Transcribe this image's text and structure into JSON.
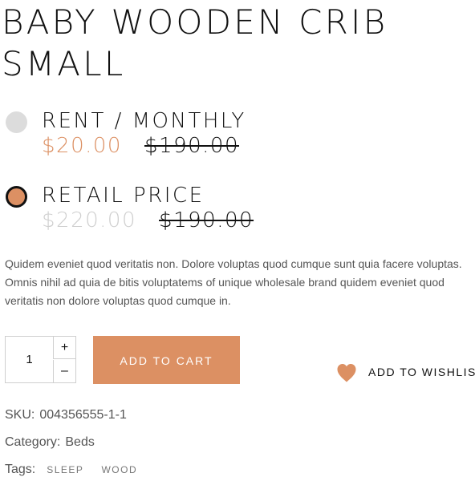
{
  "product": {
    "title": "BABY WOODEN CRIB SMALL"
  },
  "options": {
    "rent": {
      "label": "RENT / MONTHLY",
      "price": "$20.00",
      "old_price": "$190.00",
      "selected": false
    },
    "retail": {
      "label": "RETAIL PRICE",
      "price": "$220.00",
      "old_price": "$190.00",
      "selected": true
    }
  },
  "description": "Quidem eveniet quod veritatis non. Dolore voluptas quod cumque sunt quia facere voluptas. Omnis nihil ad quia de bitis voluptatems of unique wholesale brand quidem eveniet quod veritatis non dolore voluptas quod cumque in.",
  "quantity": {
    "value": "1",
    "increment": "+",
    "decrement": "–"
  },
  "actions": {
    "add_to_cart": "ADD TO CART",
    "wishlist": "ADD TO WISHLIST",
    "wishlist_icon": "heart-icon"
  },
  "meta": {
    "sku_label": "SKU:",
    "sku": "004356555-1-1",
    "category_label": "Category:",
    "category": "Beds",
    "tags_label": "Tags:",
    "tags": [
      "SLEEP",
      "WOOD"
    ]
  },
  "colors": {
    "accent": "#dc9063",
    "muted_price": "#cfcfcf",
    "radio_unchecked": "#dcdcdc"
  }
}
